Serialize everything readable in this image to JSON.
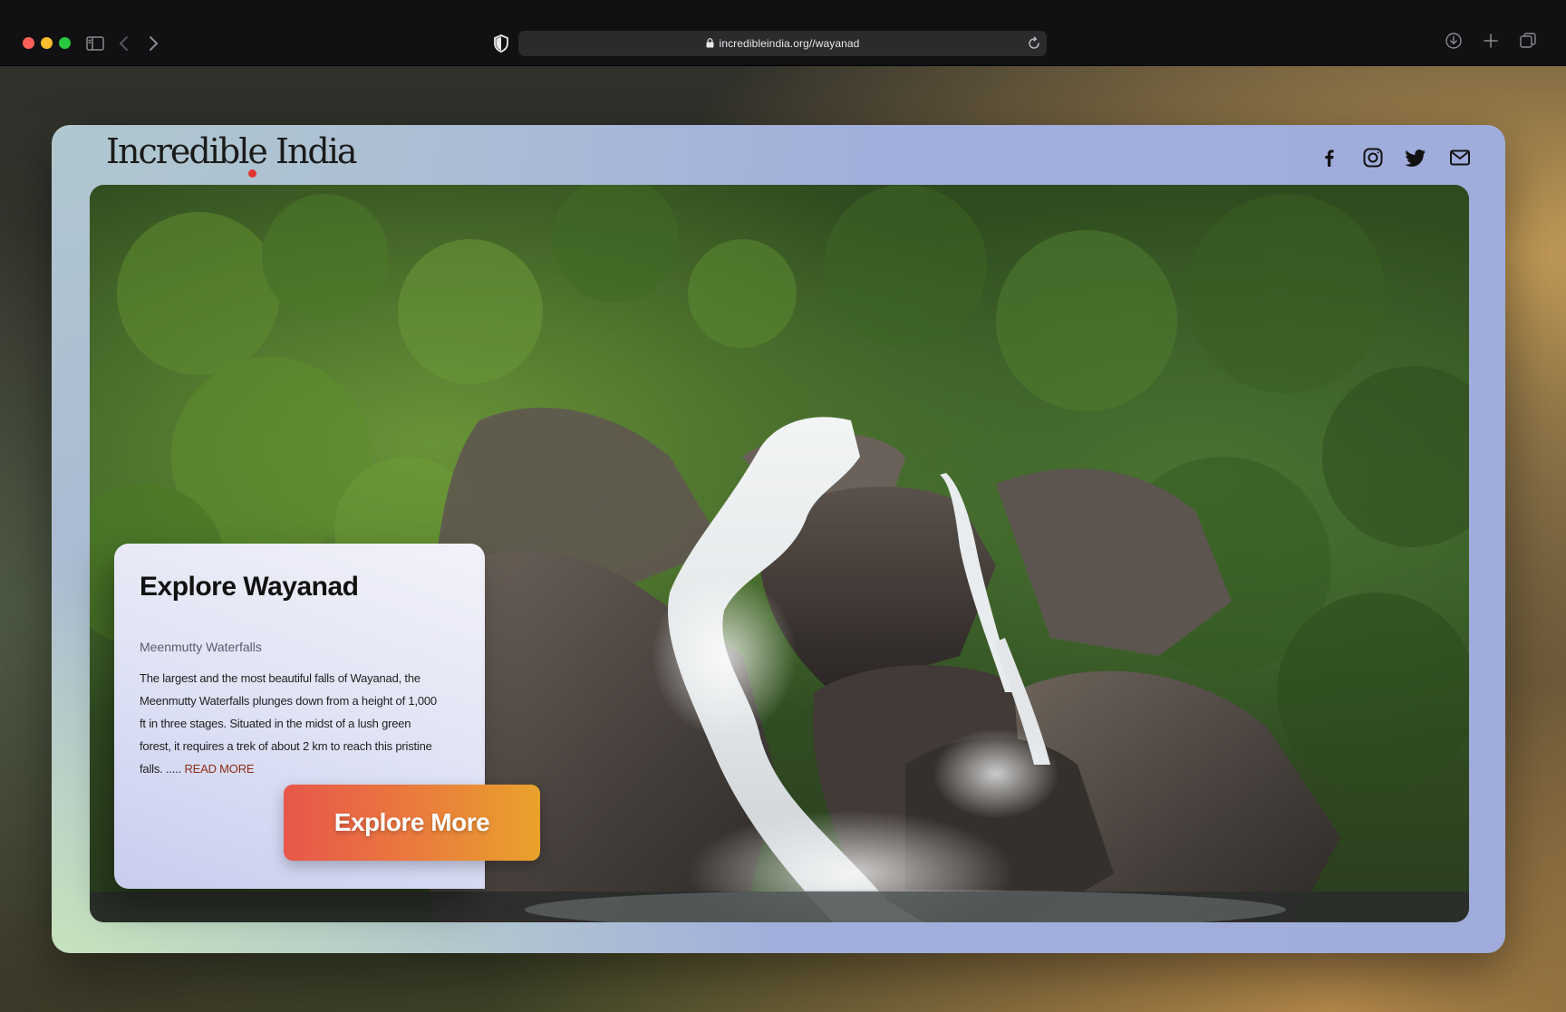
{
  "browser": {
    "url": "incredibleindia.org//wayanad"
  },
  "site": {
    "logo_text": "Incredible India",
    "social": [
      "facebook-icon",
      "instagram-icon",
      "twitter-icon",
      "mail-icon"
    ]
  },
  "hero": {
    "image": "waterfall-forest-photo"
  },
  "info": {
    "title": "Explore Wayanad",
    "subtitle": "Meenmutty Waterfalls",
    "body": "The largest and the most beautiful falls of Wayanad, the Meenmutty Waterfalls plunges down from a height of 1,000 ft in three stages. Situated in the midst of a lush green forest, it requires a trek of about 2 km to reach this pristine falls. .....",
    "read_more": "READ MORE",
    "cta": "Explore More"
  },
  "colors": {
    "accent_start": "#e8564a",
    "accent_end": "#e9a22c",
    "read_more": "#8b2d14"
  }
}
